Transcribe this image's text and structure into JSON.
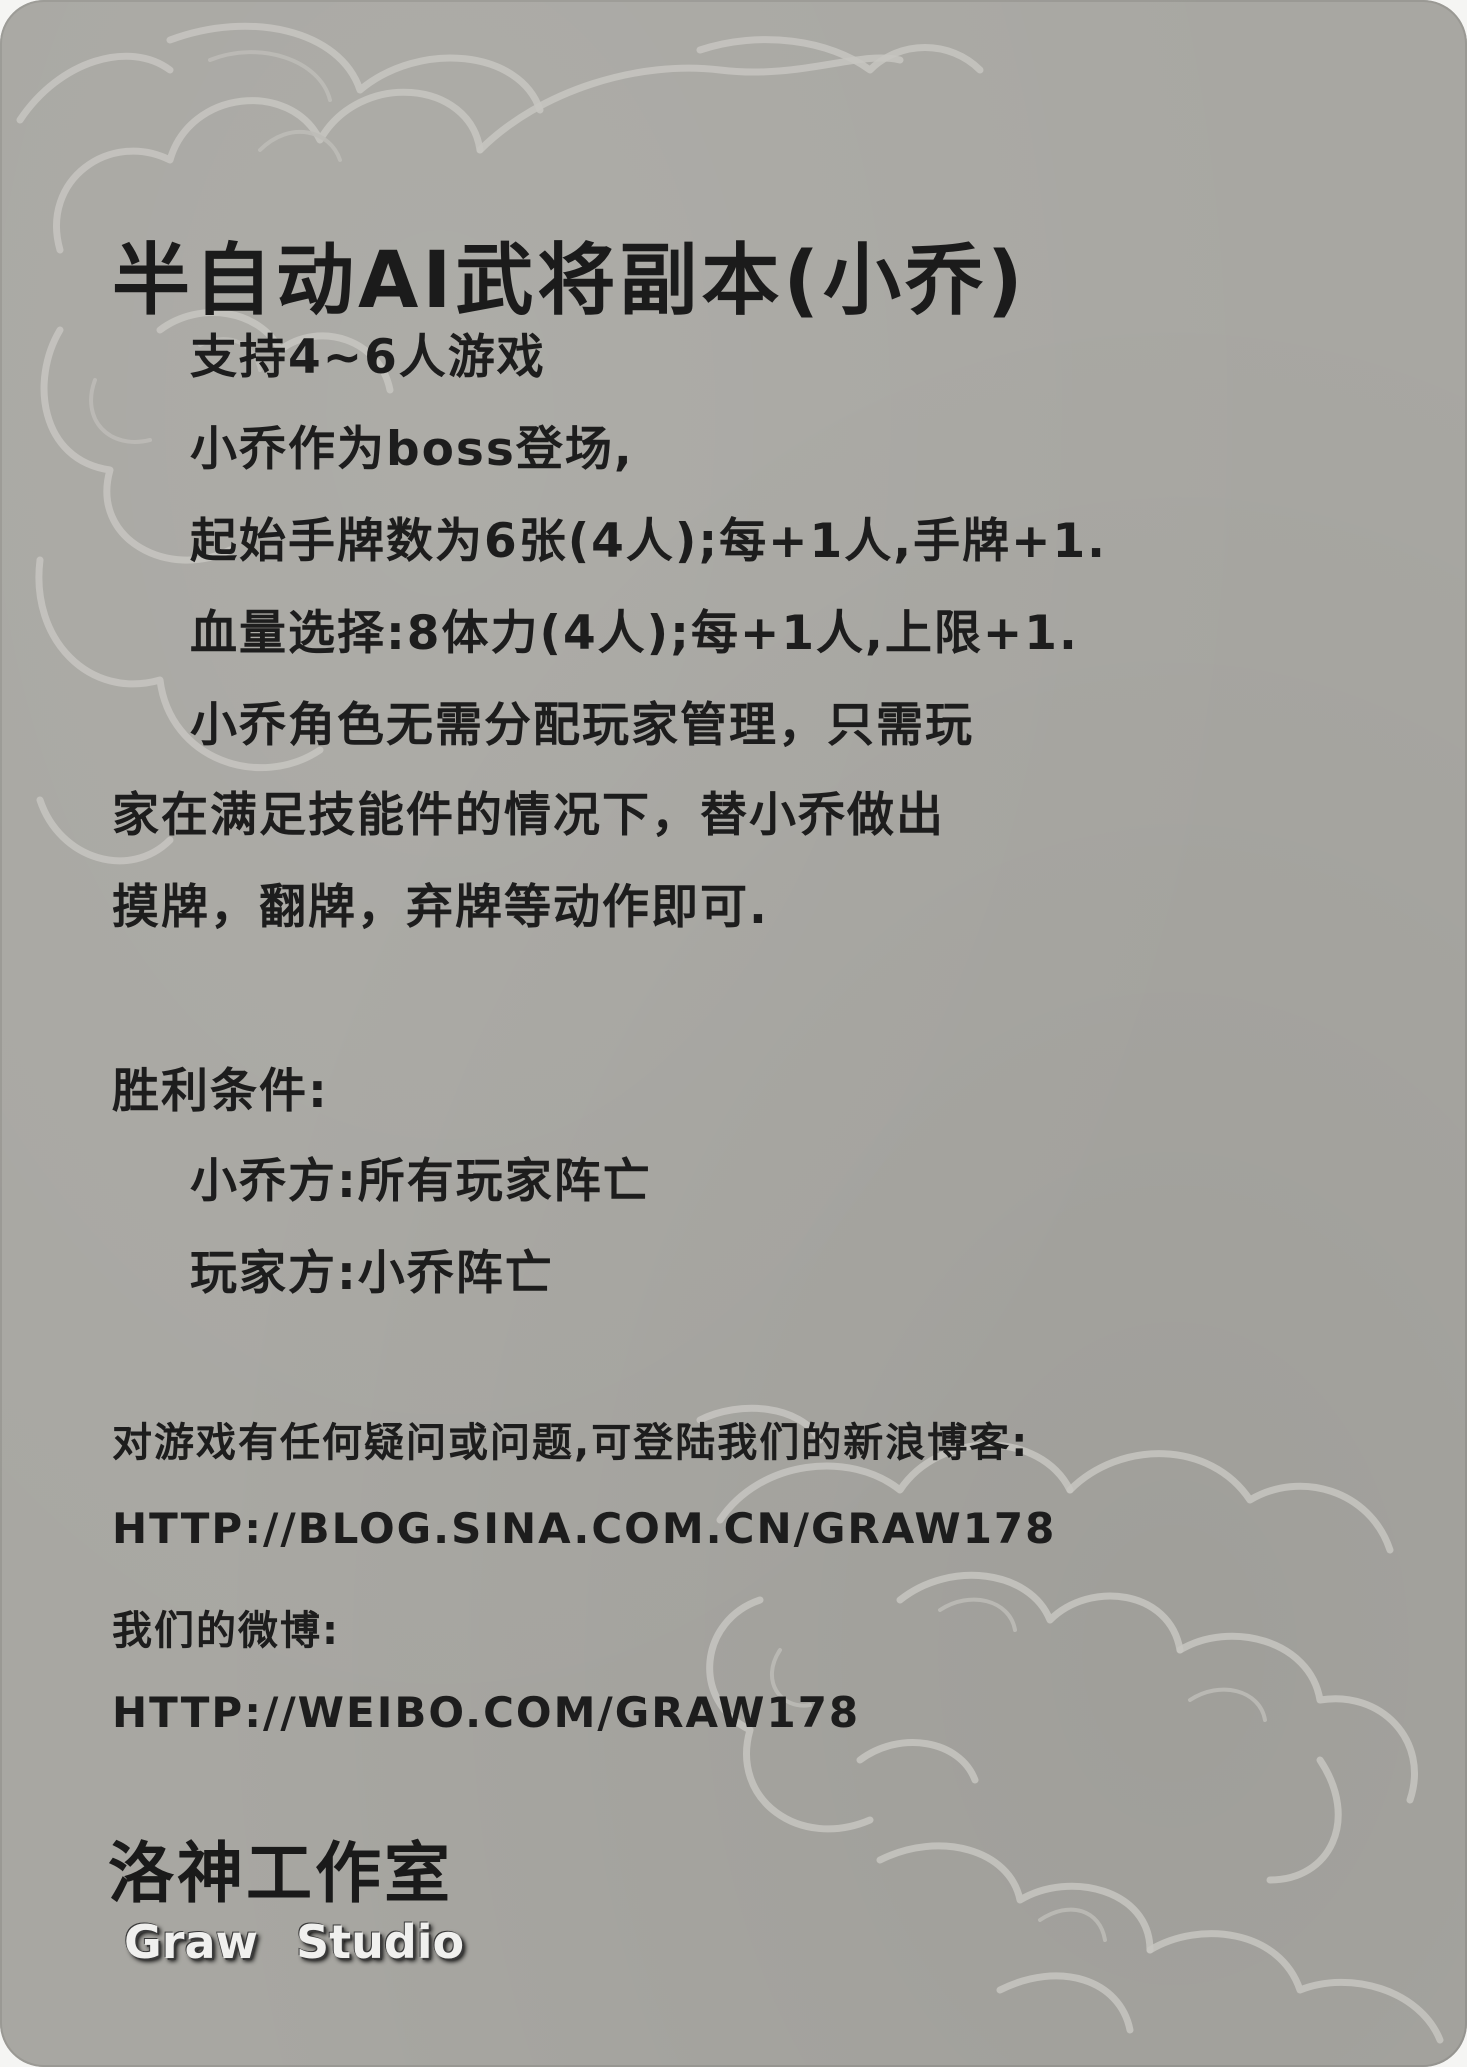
{
  "card": {
    "background_color": "#a8a7a2",
    "cloud_color": "#c7c6c1",
    "text_color": "#1d1d1d"
  },
  "title": "半自动AI武将副本(小乔)",
  "rules": [
    "支持4~6人游戏",
    "小乔作为boss登场,",
    "起始手牌数为6张(4人);每+1人,手牌+1.",
    "血量选择:8体力(4人);每+1人,上限+1.",
    "小乔角色无需分配玩家管理，只需玩",
    "家在满足技能件的情况下，替小乔做出",
    "摸牌，翻牌，弃牌等动作即可."
  ],
  "victory": {
    "heading": "胜利条件:",
    "boss_side": "小乔方:所有玩家阵亡",
    "player_side": "玩家方:小乔阵亡"
  },
  "contact": {
    "prompt": "对游戏有任何疑问或问题,可登陆我们的新浪博客:",
    "blog_url": "HTTP://BLOG.SINA.COM.CN/GRAW178",
    "weibo_label": "我们的微博:",
    "weibo_url": "HTTP://WEIBO.COM/GRAW178"
  },
  "studio": {
    "name_cn": "洛神工作室",
    "name_en": "Graw Studio"
  }
}
